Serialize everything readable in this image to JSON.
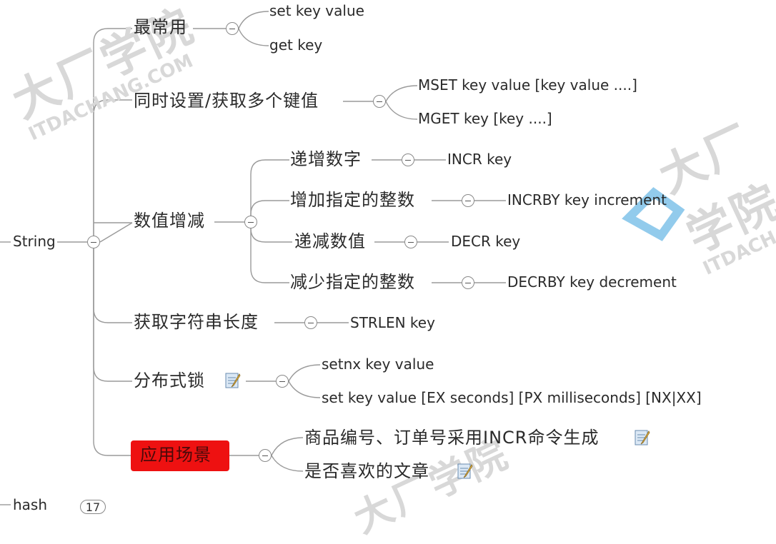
{
  "root": {
    "label": "String"
  },
  "sibling": {
    "label": "hash",
    "count": "17"
  },
  "branches": {
    "most_used": {
      "label": "最常用",
      "children": [
        "set key value",
        "get key"
      ]
    },
    "multi": {
      "label": "同时设置/获取多个键值",
      "children": [
        "MSET key value [key value ....]",
        "MGET key [key ....]"
      ]
    },
    "numeric": {
      "label": "数值增减",
      "items": [
        {
          "label": "递增数字",
          "cmd": "INCR key"
        },
        {
          "label": "增加指定的整数",
          "cmd": "INCRBY key increment"
        },
        {
          "label": "递减数值",
          "cmd": "DECR key"
        },
        {
          "label": "减少指定的整数",
          "cmd": "DECRBY key decrement"
        }
      ]
    },
    "strlen": {
      "label": "获取字符串长度",
      "cmd": "STRLEN key"
    },
    "lock": {
      "label": "分布式锁",
      "children": [
        "setnx key value",
        "set key value [EX seconds] [PX milliseconds] [NX|XX]"
      ]
    },
    "scenes": {
      "label": "应用场景",
      "children": [
        "商品编号、订单号采用INCR命令生成",
        "是否喜欢的文章"
      ]
    }
  },
  "watermark": {
    "cn": "大厂学院",
    "en": "ITDACHANG.COM",
    "en2": "ITDACHANG"
  },
  "colors": {
    "line": "#9a9a9a",
    "highlight": "#ee1111",
    "watermark": "#d8d8d8",
    "watermark_logo": "#4aa8e0"
  }
}
